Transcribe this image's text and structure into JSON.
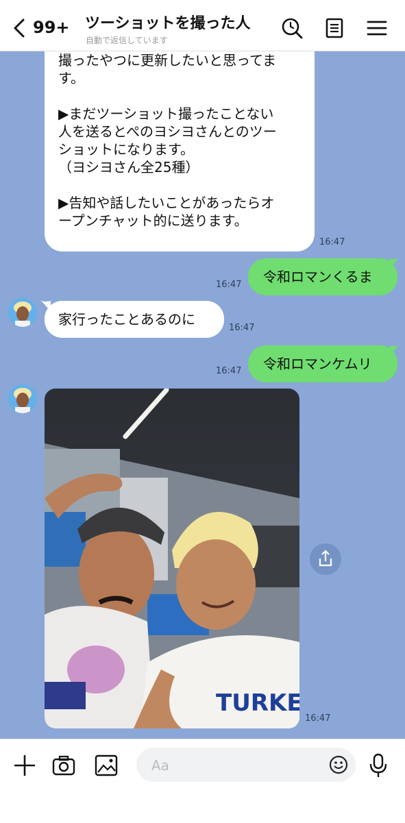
{
  "header": {
    "unread_count": "99+",
    "title": "ツーショットを撮った人",
    "subtitle": "自動で返信しています",
    "icons": [
      "back-chevron-icon",
      "search-icon",
      "notes-icon",
      "menu-icon"
    ]
  },
  "messages": [
    {
      "side": "in",
      "text": "撮ったやつに更新したいと思ってま\nす。\n\n▶まだツーショット撮ったことない\n人を送るとぺのヨシヨさんとのツー\nショットになります。\n（ヨシヨさん全25種）\n\n▶告知や話したいことがあったらオ\nープンチャット的に送ります。",
      "time": "16:47"
    },
    {
      "side": "out",
      "text": "令和ロマンくるま",
      "time": "16:47"
    },
    {
      "side": "in",
      "text": "家行ったことあるのに",
      "time": "16:47"
    },
    {
      "side": "out",
      "text": "令和ロマンケムリ",
      "time": "16:47"
    },
    {
      "side": "in",
      "type": "photo",
      "time": "16:47",
      "photo_text": "TURKEY"
    }
  ],
  "input": {
    "placeholder": "Aa",
    "icons": [
      "plus-icon",
      "camera-icon",
      "image-icon",
      "emoji-icon",
      "mic-icon",
      "share-icon"
    ]
  },
  "colors": {
    "chat_background": "#8aa7d8",
    "outgoing_bubble": "#6fdd6f",
    "incoming_bubble": "#ffffff"
  }
}
